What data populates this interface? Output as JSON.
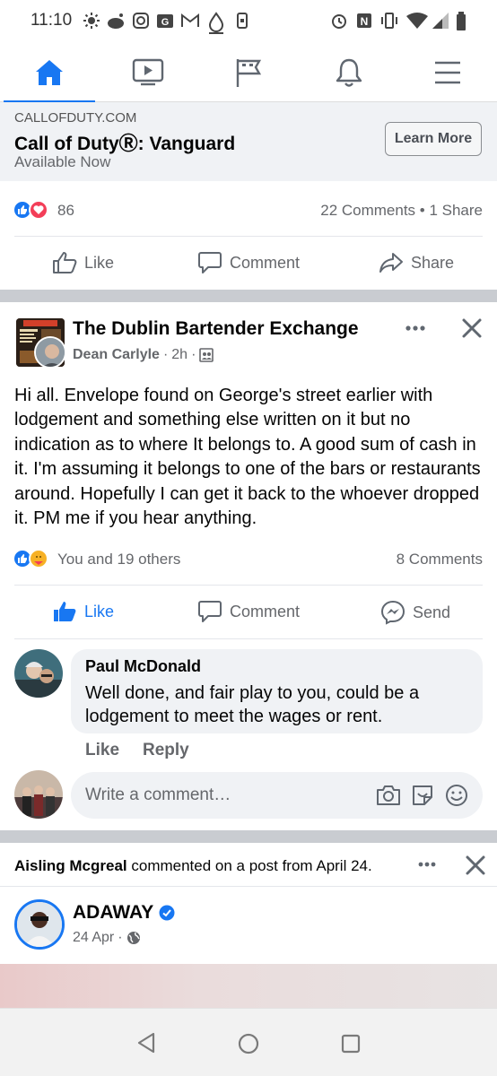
{
  "status_bar": {
    "time": "11:10"
  },
  "nav": {
    "tabs": [
      {
        "name": "home-tab",
        "icon": "home-icon",
        "active": true
      },
      {
        "name": "watch-tab",
        "icon": "video-icon",
        "active": false
      },
      {
        "name": "pages-tab",
        "icon": "flag-icon",
        "active": false
      },
      {
        "name": "notifications-tab",
        "icon": "bell-icon",
        "active": false
      },
      {
        "name": "menu-tab",
        "icon": "hamburger-icon",
        "active": false
      }
    ],
    "accent": "#1877f2"
  },
  "ad": {
    "domain": "CALLOFDUTY.COM",
    "title": "Call of DutyⓇ: Vanguard",
    "subtitle": "Available Now",
    "cta": "Learn More",
    "reactions_count": "86",
    "comments_shares": "22 Comments • 1 Share",
    "actions": {
      "like": "Like",
      "comment": "Comment",
      "share": "Share"
    }
  },
  "post": {
    "group": "The Dublin Bartender Exchange",
    "author": "Dean Carlyle",
    "time": "2h",
    "body": "Hi all. Envelope found on George's street earlier with lodgement and something else written on it but no indication as to where It belongs to. A good sum of cash in it. I'm assuming it belongs to one of the bars or restaurants around. Hopefully I can get it back to the whoever dropped it. PM me if you hear anything.",
    "reactions_text": "You and 19 others",
    "comments_count": "8 Comments",
    "actions": {
      "like": "Like",
      "comment": "Comment",
      "send": "Send"
    },
    "like_active": true,
    "comment": {
      "author": "Paul McDonald",
      "text": "Well done, and fair play to you, could be a lodgement to meet the wages or rent.",
      "like": "Like",
      "reply": "Reply"
    },
    "write_placeholder": "Write a comment…"
  },
  "next_post": {
    "activity_author": "Aisling Mcgreal",
    "activity_text": " commented on a post from April 24.",
    "page_name": "ADAWAY",
    "date": "24 Apr"
  }
}
